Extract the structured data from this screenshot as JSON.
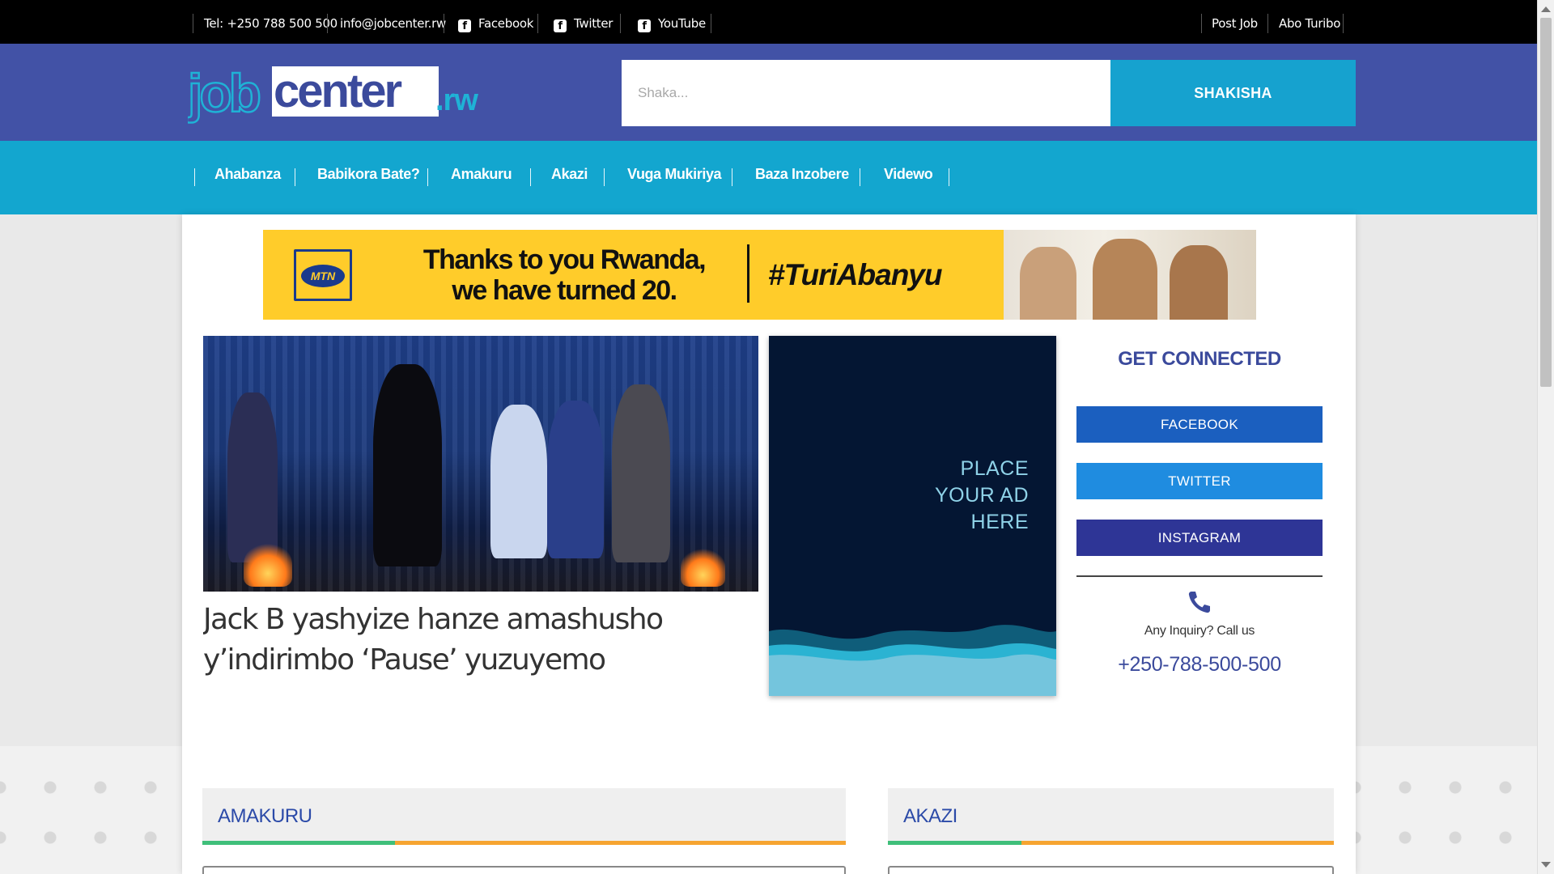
{
  "topbar": {
    "phone": "Tel: +250 788 500 500",
    "email": "info@jobcenter.rw",
    "facebook": "Facebook",
    "twitter": "Twitter",
    "youtube": "YouTube",
    "post_job": "Post Job",
    "abo_turibo": "Abo Turibo"
  },
  "logo": {
    "part1": "job",
    "part2": "center",
    "part3": ".rw"
  },
  "search": {
    "placeholder": "Shaka...",
    "button": "SHAKISHA"
  },
  "nav": [
    "Ahabanza",
    "Babikora Bate?",
    "Amakuru",
    "Akazi",
    "Vuga Mukiriya",
    "Baza Inzobere",
    "Videwo"
  ],
  "banner": {
    "brand": "MTN",
    "line1": "Thanks to you Rwanda,",
    "line2": "we have turned 20.",
    "hashtag": "#TuriAbanyu"
  },
  "featured": {
    "title": "Jack B yashyize hanze amashusho y’indirimbo ‘Pause’ yuzuyemo"
  },
  "ad": {
    "line1": "PLACE",
    "line2": "YOUR AD",
    "line3": "HERE"
  },
  "sidebar": {
    "title": "GET CONNECTED",
    "facebook": "FACEBOOK",
    "twitter": "TWITTER",
    "instagram": "INSTAGRAM",
    "inquiry": "Any Inquiry? Call us",
    "phone": "+250-788-500-500"
  },
  "sections": {
    "left": "AMAKURU",
    "right": "AKAZI"
  },
  "colors": {
    "header": "#4252a6",
    "nav": "#13a6cf",
    "facebook_btn": "#1b5fbf",
    "twitter_btn": "#1f8ce0",
    "instagram_btn": "#2e3596",
    "accent_green": "#3fbf7a",
    "accent_orange": "#f6a430"
  }
}
